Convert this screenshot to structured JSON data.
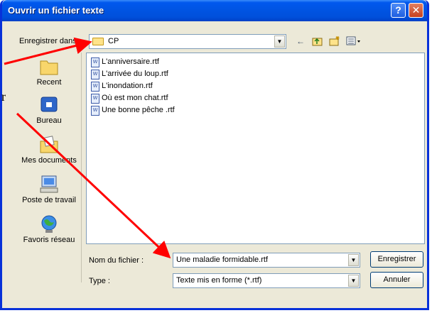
{
  "window": {
    "title": "Ouvrir un fichier texte"
  },
  "titlebar": {
    "help_label": "?",
    "close_label": "✕"
  },
  "location": {
    "label": "Enregistrer dans :",
    "value": "CP"
  },
  "toolbar": {
    "back_icon": "back-arrow-icon",
    "up_icon": "up-folder-icon",
    "new_folder_icon": "new-folder-icon",
    "views_icon": "views-menu-icon"
  },
  "places": [
    {
      "label": "Recent",
      "icon": "recent-folder-icon"
    },
    {
      "label": "Bureau",
      "icon": "desktop-icon"
    },
    {
      "label": "Mes documents",
      "icon": "my-documents-icon"
    },
    {
      "label": "Poste de travail",
      "icon": "my-computer-icon"
    },
    {
      "label": "Favoris réseau",
      "icon": "network-places-icon"
    }
  ],
  "files": [
    {
      "name": "L'anniversaire.rtf"
    },
    {
      "name": "L'arrivée du loup.rtf"
    },
    {
      "name": "L'inondation.rtf"
    },
    {
      "name": "Où est mon chat.rtf"
    },
    {
      "name": "Une bonne pêche .rtf"
    }
  ],
  "filename": {
    "label": "Nom du fichier :",
    "value": "Une maladie formidable.rtf"
  },
  "filetype": {
    "label": "Type :",
    "value": "Texte mis en forme (*.rtf)"
  },
  "buttons": {
    "save": "Enregistrer",
    "cancel": "Annuler"
  },
  "stray_text": "r",
  "colors": {
    "titlebar": "#0054e3",
    "annotation": "#ff0000",
    "window_bg": "#ece9d8"
  }
}
